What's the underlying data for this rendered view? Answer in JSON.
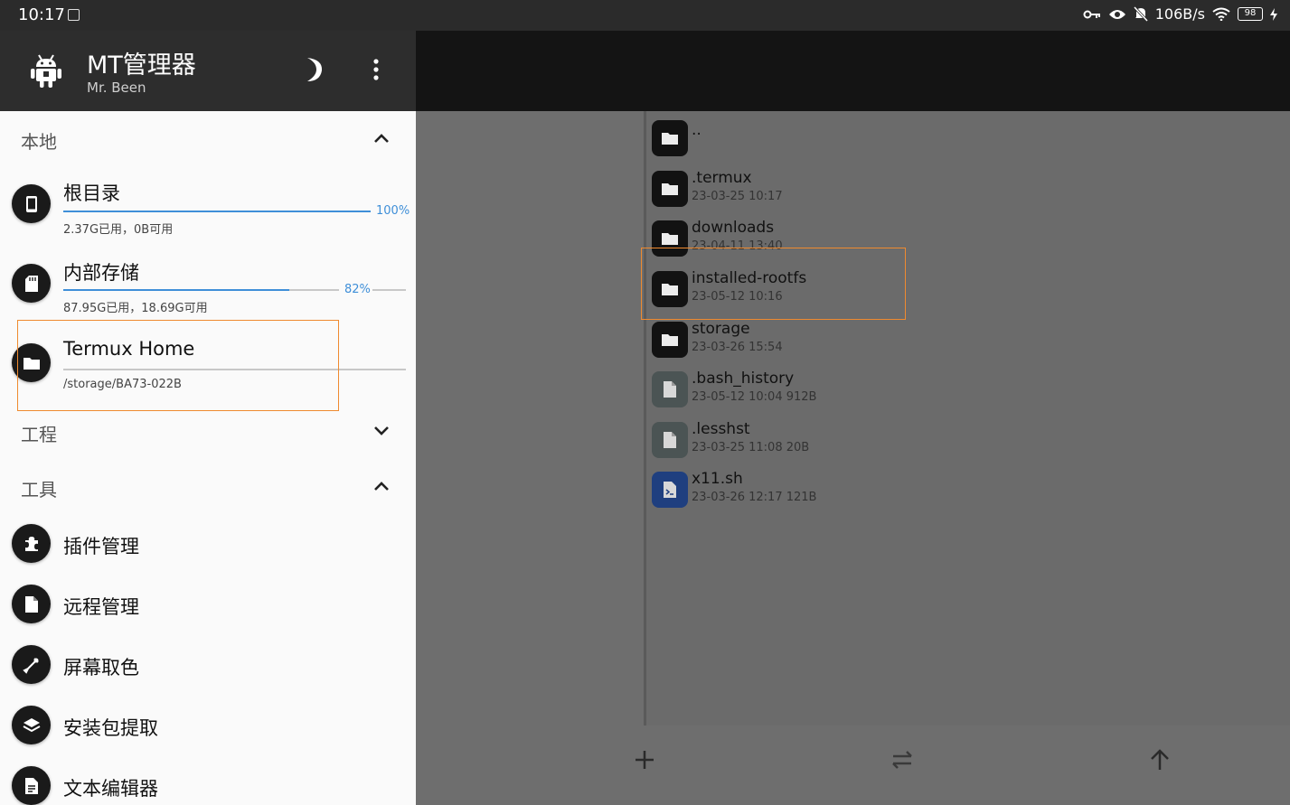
{
  "status_bar": {
    "time": "10:17",
    "net_speed": "106B/s",
    "battery": "98",
    "icons": [
      "calendar-icon",
      "key-icon",
      "eye-icon",
      "bell-off-icon",
      "wifi-icon",
      "battery-icon",
      "charging-icon"
    ]
  },
  "drawer": {
    "app_title": "MT管理器",
    "user": "Mr. Been",
    "sections": {
      "local": "本地",
      "project": "工程",
      "tools": "工具"
    },
    "local_items": [
      {
        "title": "根目录",
        "sub": "2.37G已用，0B可用",
        "pct_label": "100%",
        "pct": 100
      },
      {
        "title": "内部存储",
        "sub": "87.95G已用，18.69G可用",
        "pct_label": "82%",
        "pct": 82
      },
      {
        "title": "Termux Home",
        "sub": "/storage/BA73-022B"
      }
    ],
    "tool_items": [
      {
        "title": "插件管理",
        "icon": "puzzle-icon"
      },
      {
        "title": "远程管理",
        "icon": "document-icon"
      },
      {
        "title": "屏幕取色",
        "icon": "eyedropper-icon"
      },
      {
        "title": "安装包提取",
        "icon": "layers-icon"
      },
      {
        "title": "文本编辑器",
        "icon": "text-file-icon"
      }
    ]
  },
  "files": [
    {
      "name": "..",
      "meta": "",
      "type": "folder"
    },
    {
      "name": ".termux",
      "meta": "23-03-25 10:17",
      "type": "folder"
    },
    {
      "name": "downloads",
      "meta": "23-04-11 13:40",
      "type": "folder"
    },
    {
      "name": "installed-rootfs",
      "meta": "23-05-12 10:16",
      "type": "folder"
    },
    {
      "name": "storage",
      "meta": "23-03-26 15:54",
      "type": "folder"
    },
    {
      "name": ".bash_history",
      "meta": "23-05-12 10:04  912B",
      "type": "doc"
    },
    {
      "name": ".lesshst",
      "meta": "23-03-25 11:08  20B",
      "type": "doc"
    },
    {
      "name": "x11.sh",
      "meta": "23-03-26 12:17  121B",
      "type": "sh"
    }
  ],
  "colors": {
    "accent": "#3f8fd8",
    "highlight": "#ef8a2f"
  }
}
